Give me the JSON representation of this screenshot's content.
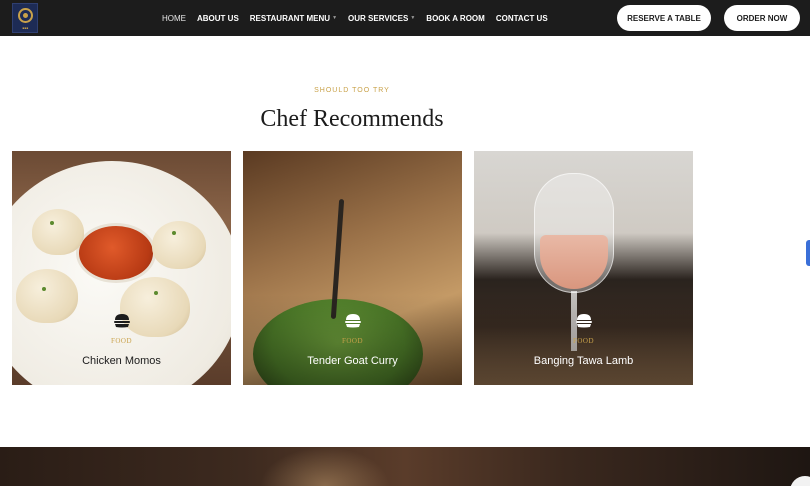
{
  "header": {
    "logo_icon": "restaurant-logo",
    "nav": [
      {
        "label": "HOME",
        "active": true,
        "dropdown": false
      },
      {
        "label": "ABOUT US",
        "active": false,
        "dropdown": false
      },
      {
        "label": "RESTAURANT MENU",
        "active": false,
        "dropdown": true
      },
      {
        "label": "OUR SERVICES",
        "active": false,
        "dropdown": true
      },
      {
        "label": "BOOK A ROOM",
        "active": false,
        "dropdown": false
      },
      {
        "label": "CONTACT US",
        "active": false,
        "dropdown": false
      }
    ],
    "reserve_label": "RESERVE A TABLE",
    "order_label": "ORDER NOW"
  },
  "section": {
    "eyebrow": "SHOULD TOO TRY",
    "title": "Chef Recommends"
  },
  "cards": [
    {
      "icon": "burger-icon",
      "category": "FOOD",
      "name": "Chicken Momos"
    },
    {
      "icon": "burger-icon",
      "category": "FOOD",
      "name": "Tender Goat Curry"
    },
    {
      "icon": "burger-icon",
      "category": "FOOD",
      "name": "Banging Tawa Lamb"
    }
  ],
  "colors": {
    "accent": "#c9a24a",
    "nav_bg": "#1c1c1c",
    "side_tab": "#3a6fd8"
  }
}
